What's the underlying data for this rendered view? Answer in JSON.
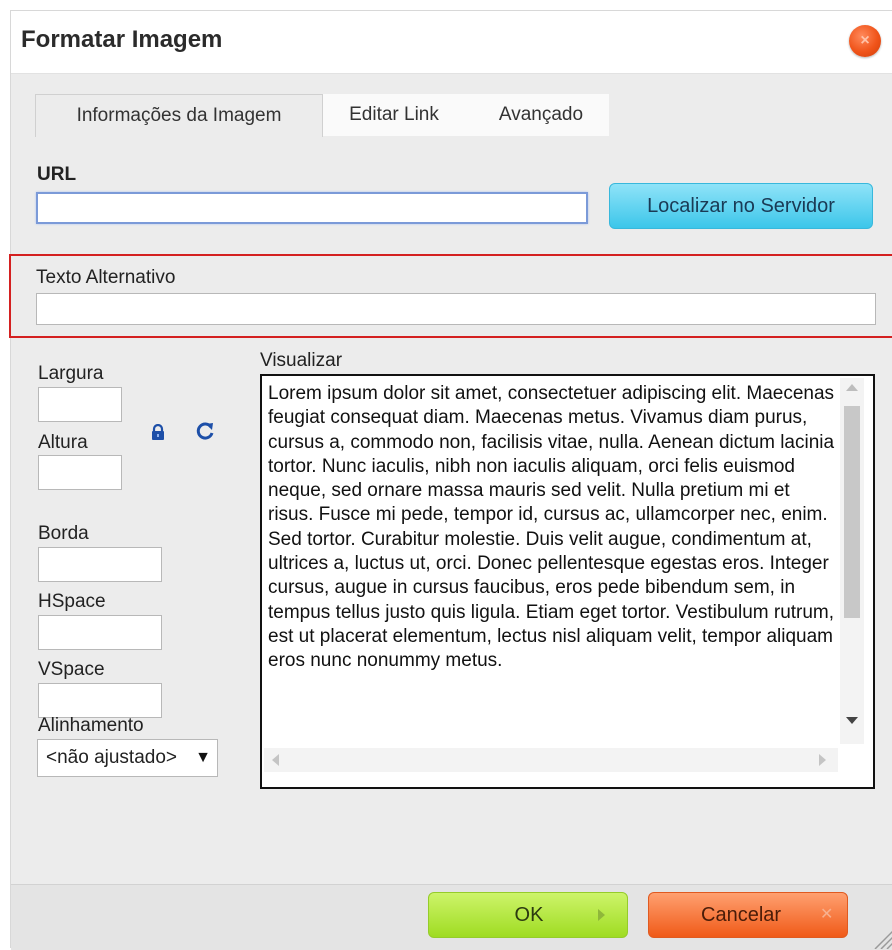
{
  "dialog": {
    "title": "Formatar Imagem",
    "close_icon": "close-icon"
  },
  "tabs": [
    {
      "label": "Informações da Imagem",
      "active": true
    },
    {
      "label": "Editar Link",
      "active": false
    },
    {
      "label": "Avançado",
      "active": false
    }
  ],
  "url": {
    "label": "URL",
    "value": "",
    "browse_button": "Localizar no Servidor"
  },
  "alt_text": {
    "label": "Texto Alternativo",
    "value": ""
  },
  "dimensions": {
    "width_label": "Largura",
    "width_value": "",
    "height_label": "Altura",
    "height_value": "",
    "lock_icon": "lock-icon",
    "reset_icon": "reset-size-icon"
  },
  "fields": {
    "border_label": "Borda",
    "border_value": "",
    "hspace_label": "HSpace",
    "hspace_value": "",
    "vspace_label": "VSpace",
    "vspace_value": "",
    "align_label": "Alinhamento",
    "align_value": "<não ajustado>"
  },
  "preview": {
    "label": "Visualizar",
    "text": "Lorem ipsum dolor sit amet, consectetuer adipiscing elit. Maecenas feugiat consequat diam. Maecenas metus. Vivamus diam purus, cursus a, commodo non, facilisis vitae, nulla. Aenean dictum lacinia tortor. Nunc iaculis, nibh non iaculis aliquam, orci felis euismod neque, sed ornare massa mauris sed velit. Nulla pretium mi et risus. Fusce mi pede, tempor id, cursus ac, ullamcorper nec, enim. Sed tortor. Curabitur molestie. Duis velit augue, condimentum at, ultrices a, luctus ut, orci. Donec pellentesque egestas eros. Integer cursus, augue in cursus faucibus, eros pede bibendum sem, in tempus tellus justo quis ligula. Etiam eget tortor. Vestibulum rutrum, est ut placerat elementum, lectus nisl aliquam velit, tempor aliquam eros nunc nonummy metus."
  },
  "footer": {
    "ok_label": "OK",
    "cancel_label": "Cancelar"
  },
  "colors": {
    "ok_button": "#a8e22e",
    "cancel_button": "#f26522",
    "browse_button": "#3fc6ea",
    "highlight_border": "#d42020"
  }
}
